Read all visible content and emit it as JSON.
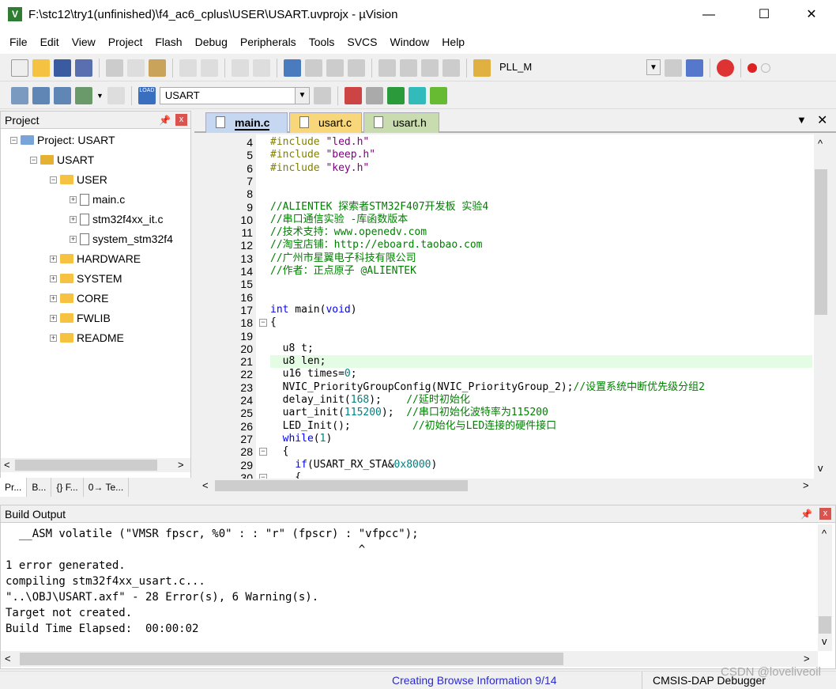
{
  "window": {
    "title": "F:\\stc12\\try1(unfinished)\\f4_ac6_cplus\\USER\\USART.uvprojx - µVision",
    "minimize": "—",
    "maximize": "☐",
    "close": "✕"
  },
  "menu": [
    "File",
    "Edit",
    "View",
    "Project",
    "Flash",
    "Debug",
    "Peripherals",
    "Tools",
    "SVCS",
    "Window",
    "Help"
  ],
  "toolbar1": {
    "target_combo": "PLL_M"
  },
  "toolbar2": {
    "target_select": "USART",
    "load_label": "LOAD"
  },
  "project_panel": {
    "title": "Project",
    "pin": "ᵖ",
    "close": "x",
    "tree": [
      {
        "label": "Project: USART",
        "level": 0,
        "type": "project",
        "exp": "−"
      },
      {
        "label": "USART",
        "level": 1,
        "type": "target",
        "exp": "−"
      },
      {
        "label": "USER",
        "level": 2,
        "type": "folder",
        "exp": "−"
      },
      {
        "label": "main.c",
        "level": 3,
        "type": "file",
        "exp": "+"
      },
      {
        "label": "stm32f4xx_it.c",
        "level": 3,
        "type": "file",
        "exp": "+"
      },
      {
        "label": "system_stm32f4",
        "level": 3,
        "type": "file",
        "exp": "+"
      },
      {
        "label": "HARDWARE",
        "level": 2,
        "type": "folder",
        "exp": "+"
      },
      {
        "label": "SYSTEM",
        "level": 2,
        "type": "folder",
        "exp": "+"
      },
      {
        "label": "CORE",
        "level": 2,
        "type": "folder",
        "exp": "+"
      },
      {
        "label": "FWLIB",
        "level": 2,
        "type": "folder",
        "exp": "+"
      },
      {
        "label": "README",
        "level": 2,
        "type": "folder",
        "exp": "+"
      }
    ],
    "bottom_tabs": [
      "Pr...",
      "B...",
      "{} F...",
      "0→ Te..."
    ]
  },
  "editor": {
    "tabs": [
      {
        "label": "main.c",
        "active": true,
        "color": "#c6d7f2"
      },
      {
        "label": "usart.c",
        "active": false,
        "color": "#f8d77a"
      },
      {
        "label": "usart.h",
        "active": false,
        "color": "#c8dcb0"
      }
    ],
    "highlight_line": 21,
    "lines": [
      {
        "n": 4,
        "s": [
          [
            "#include ",
            "pp"
          ],
          [
            "\"led.h\"",
            "str"
          ]
        ]
      },
      {
        "n": 5,
        "s": [
          [
            "#include ",
            "pp"
          ],
          [
            "\"beep.h\"",
            "str"
          ]
        ]
      },
      {
        "n": 6,
        "s": [
          [
            "#include ",
            "pp"
          ],
          [
            "\"key.h\"",
            "str"
          ]
        ]
      },
      {
        "n": 7,
        "s": []
      },
      {
        "n": 8,
        "s": []
      },
      {
        "n": 9,
        "s": [
          [
            "//ALIENTEK 探索者STM32F407开发板 实验4",
            "cm"
          ]
        ]
      },
      {
        "n": 10,
        "s": [
          [
            "//串口通信实验 -库函数版本",
            "cm"
          ]
        ]
      },
      {
        "n": 11,
        "s": [
          [
            "//技术支持：www.openedv.com",
            "cm"
          ]
        ]
      },
      {
        "n": 12,
        "s": [
          [
            "//淘宝店铺：http://eboard.taobao.com",
            "cm"
          ]
        ]
      },
      {
        "n": 13,
        "s": [
          [
            "//广州市星翼电子科技有限公司",
            "cm"
          ]
        ]
      },
      {
        "n": 14,
        "s": [
          [
            "//作者：正点原子 @ALIENTEK",
            "cm"
          ]
        ]
      },
      {
        "n": 15,
        "s": []
      },
      {
        "n": 16,
        "s": []
      },
      {
        "n": 17,
        "s": [
          [
            "int",
            "kw"
          ],
          [
            " main(",
            ""
          ],
          [
            "void",
            "kw"
          ],
          [
            ")",
            ""
          ]
        ]
      },
      {
        "n": 18,
        "fold": "−",
        "s": [
          [
            "{",
            ""
          ]
        ]
      },
      {
        "n": 19,
        "s": []
      },
      {
        "n": 20,
        "s": [
          [
            "  u8 t;",
            ""
          ]
        ]
      },
      {
        "n": 21,
        "s": [
          [
            "  u8 len;",
            ""
          ]
        ]
      },
      {
        "n": 22,
        "s": [
          [
            "  u16 times=",
            ""
          ],
          [
            "0",
            "num"
          ],
          [
            ";",
            ""
          ]
        ]
      },
      {
        "n": 23,
        "s": [
          [
            "  NVIC_PriorityGroupConfig(NVIC_PriorityGroup_2);",
            ""
          ],
          [
            "//设置系统中断优先级分组2",
            "cm"
          ]
        ]
      },
      {
        "n": 24,
        "s": [
          [
            "  delay_init(",
            ""
          ],
          [
            "168",
            "num"
          ],
          [
            ");    ",
            ""
          ],
          [
            "//延时初始化",
            "cm"
          ]
        ]
      },
      {
        "n": 25,
        "s": [
          [
            "  uart_init(",
            ""
          ],
          [
            "115200",
            "num"
          ],
          [
            ");  ",
            ""
          ],
          [
            "//串口初始化波特率为115200",
            "cm"
          ]
        ]
      },
      {
        "n": 26,
        "s": [
          [
            "  LED_Init();          ",
            ""
          ],
          [
            "//初始化与LED连接的硬件接口",
            "cm"
          ]
        ]
      },
      {
        "n": 27,
        "s": [
          [
            "  ",
            ""
          ],
          [
            "while",
            "kw"
          ],
          [
            "(",
            ""
          ],
          [
            "1",
            "num"
          ],
          [
            ")",
            ""
          ]
        ]
      },
      {
        "n": 28,
        "fold": "−",
        "s": [
          [
            "  {",
            ""
          ]
        ]
      },
      {
        "n": 29,
        "s": [
          [
            "    ",
            ""
          ],
          [
            "if",
            "kw"
          ],
          [
            "(USART_RX_STA&",
            ""
          ],
          [
            "0x8000",
            "num"
          ],
          [
            ")",
            ""
          ]
        ]
      },
      {
        "n": 30,
        "fold": "−",
        "s": [
          [
            "    {",
            ""
          ]
        ]
      }
    ]
  },
  "build_output": {
    "title": "Build Output",
    "lines": [
      "  __ASM volatile (\"VMSR fpscr, %0\" : : \"r\" (fpscr) : \"vfpcc\");",
      "                                                     ^",
      "1 error generated.",
      "compiling stm32f4xx_usart.c...",
      "\"..\\OBJ\\USART.axf\" - 28 Error(s), 6 Warning(s).",
      "Target not created.",
      "Build Time Elapsed:  00:00:02"
    ]
  },
  "status": {
    "message": "Creating Browse Information 9/14",
    "debugger": "CMSIS-DAP Debugger",
    "watermark": "CSDN @loveliveoil"
  },
  "scroll_glyphs": {
    "up": "^",
    "down": "v",
    "left": "<",
    "right": ">"
  }
}
